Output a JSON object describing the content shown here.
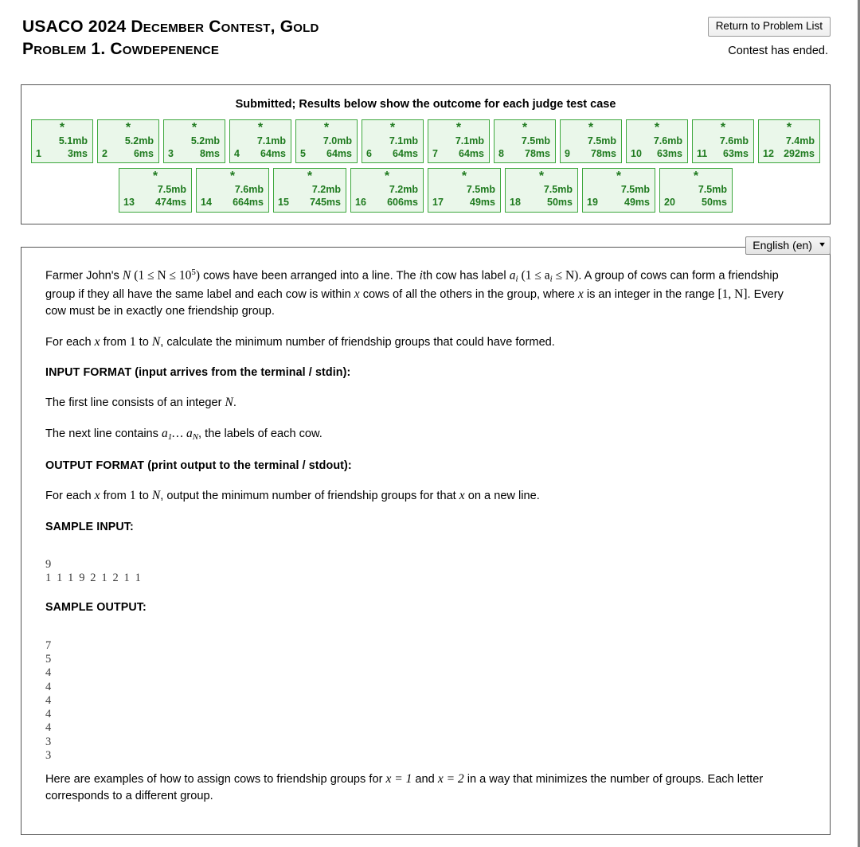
{
  "header": {
    "title_line1": "USACO 2024 December Contest, Gold",
    "title_line2": "Problem 1. Cowdepenence",
    "return_button": "Return to Problem List",
    "contest_status": "Contest has ended."
  },
  "results": {
    "heading": "Submitted; Results below show the outcome for each judge test case",
    "status_glyph": "*",
    "border_color": "#3ea83e",
    "background_color": "#eaf7ea",
    "text_color": "#1e7a1e",
    "cases": [
      {
        "index": "1",
        "memory": "5.1mb",
        "time": "3ms"
      },
      {
        "index": "2",
        "memory": "5.2mb",
        "time": "6ms"
      },
      {
        "index": "3",
        "memory": "5.2mb",
        "time": "8ms"
      },
      {
        "index": "4",
        "memory": "7.1mb",
        "time": "64ms"
      },
      {
        "index": "5",
        "memory": "7.0mb",
        "time": "64ms"
      },
      {
        "index": "6",
        "memory": "7.1mb",
        "time": "64ms"
      },
      {
        "index": "7",
        "memory": "7.1mb",
        "time": "64ms"
      },
      {
        "index": "8",
        "memory": "7.5mb",
        "time": "78ms"
      },
      {
        "index": "9",
        "memory": "7.5mb",
        "time": "78ms"
      },
      {
        "index": "10",
        "memory": "7.6mb",
        "time": "63ms"
      },
      {
        "index": "11",
        "memory": "7.6mb",
        "time": "63ms"
      },
      {
        "index": "12",
        "memory": "7.4mb",
        "time": "292ms"
      },
      {
        "index": "13",
        "memory": "7.5mb",
        "time": "474ms"
      },
      {
        "index": "14",
        "memory": "7.6mb",
        "time": "664ms"
      },
      {
        "index": "15",
        "memory": "7.2mb",
        "time": "745ms"
      },
      {
        "index": "16",
        "memory": "7.2mb",
        "time": "606ms"
      },
      {
        "index": "17",
        "memory": "7.5mb",
        "time": "49ms"
      },
      {
        "index": "18",
        "memory": "7.5mb",
        "time": "50ms"
      },
      {
        "index": "19",
        "memory": "7.5mb",
        "time": "49ms"
      },
      {
        "index": "20",
        "memory": "7.5mb",
        "time": "50ms"
      }
    ]
  },
  "language": {
    "selected": "English (en)",
    "chevron": "⌄"
  },
  "problem": {
    "intro_p1_a": "Farmer John's ",
    "intro_p1_b": " cows have been arranged into a line. The ",
    "intro_p1_c": "th cow has label ",
    "intro_p1_d": ". A group of cows can form a friendship group if they all have the same label and each cow is within ",
    "intro_p1_e": " cows of all the others in the group, where ",
    "intro_p1_f": " is an integer in the range ",
    "intro_p1_g": ". Every cow must be in exactly one friendship group.",
    "intro_p2_a": "For each ",
    "intro_p2_b": " from ",
    "intro_p2_c": " to ",
    "intro_p2_d": ", calculate the minimum number of friendship groups that could have formed.",
    "input_format_heading": "INPUT FORMAT (input arrives from the terminal / stdin):",
    "input_line1_a": "The first line consists of an integer ",
    "input_line1_b": ".",
    "input_line2_a": "The next line contains ",
    "input_line2_b": ", the labels of each cow.",
    "output_format_heading": "OUTPUT FORMAT (print output to the terminal / stdout):",
    "output_line_a": "For each ",
    "output_line_b": " from ",
    "output_line_c": " to ",
    "output_line_d": ", output the minimum number of friendship groups for that ",
    "output_line_e": " on a new line.",
    "sample_input_heading": "SAMPLE INPUT:",
    "sample_input": "9\n1 1 1 9 2 1 2 1 1",
    "sample_output_heading": "SAMPLE OUTPUT:",
    "sample_output": "7\n5\n4\n4\n4\n4\n4\n3\n3",
    "explanation_a": "Here are examples of how to assign cows to friendship groups for ",
    "explanation_b": " and ",
    "explanation_c": " in a way that minimizes the number of groups. Each letter corresponds to a different group.",
    "math": {
      "n": "N",
      "n_constraint_pre": "(1 ≤ N ≤ 10",
      "n_constraint_exp": "5",
      "n_constraint_post": ")",
      "i": "i",
      "a_i_label": "a",
      "a_i_constraint": "(1 ≤ a",
      "a_i_constraint_post": " ≤ N)",
      "x": "x",
      "range_1_n": "[1, N]",
      "one": "1",
      "a_seq": "a",
      "a_seq_mid": "… a",
      "x_eq_1": "x = 1",
      "x_eq_2": "x = 2"
    }
  }
}
